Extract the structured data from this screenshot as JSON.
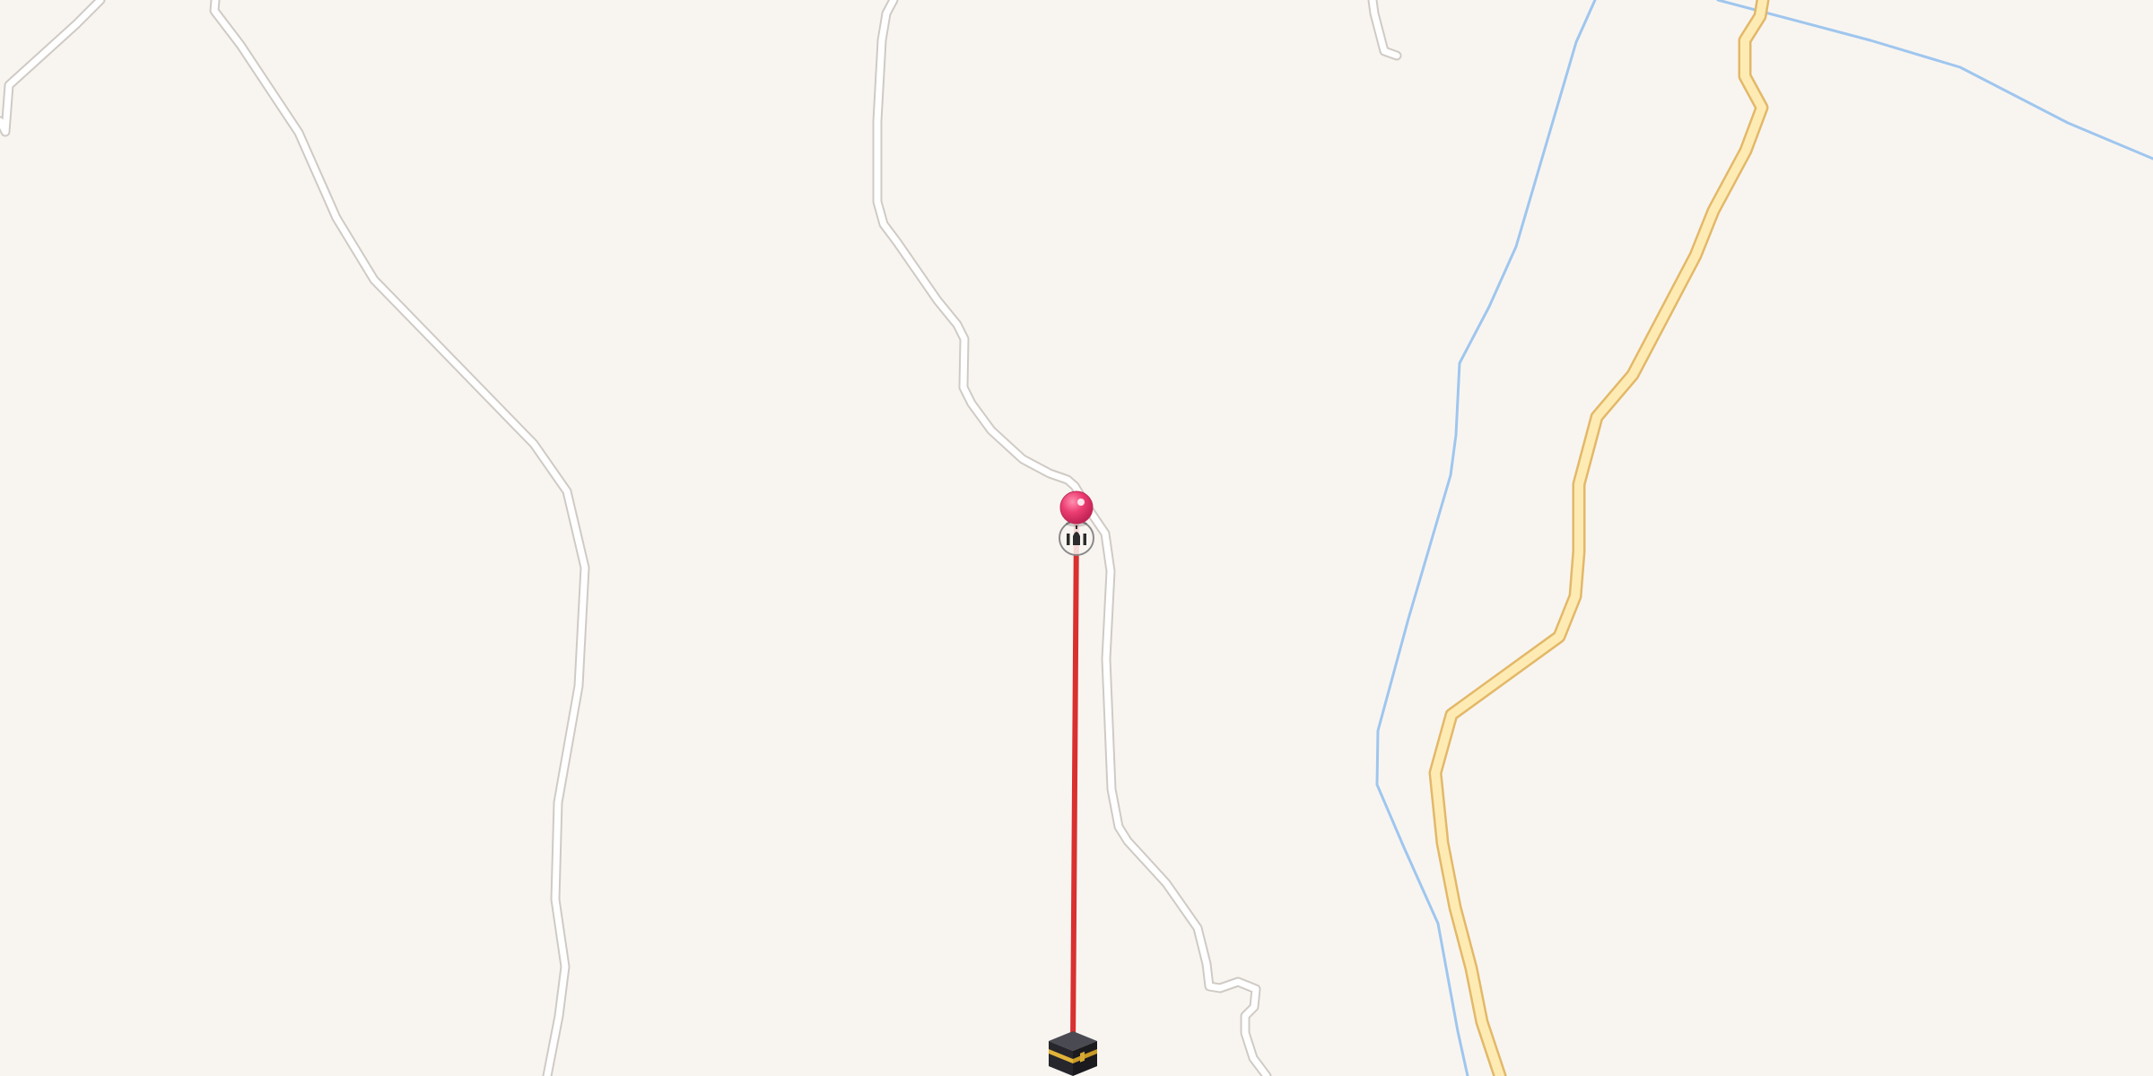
{
  "map": {
    "background_color": "#f8f5f1",
    "road_casing_color": "#cfcac4",
    "road_fill_color": "#ffffff",
    "major_road_casing_color": "#e3b868",
    "major_road_fill_color": "#fdebb3",
    "waterway_color": "#9fc6ee",
    "qibla_line_color": "#d93030",
    "location_pin_color": "#ec3d72",
    "location_pin_icon": "map-pin-icon",
    "mosque_icon": "mosque-icon",
    "kaaba_icon": "kaaba-icon"
  }
}
